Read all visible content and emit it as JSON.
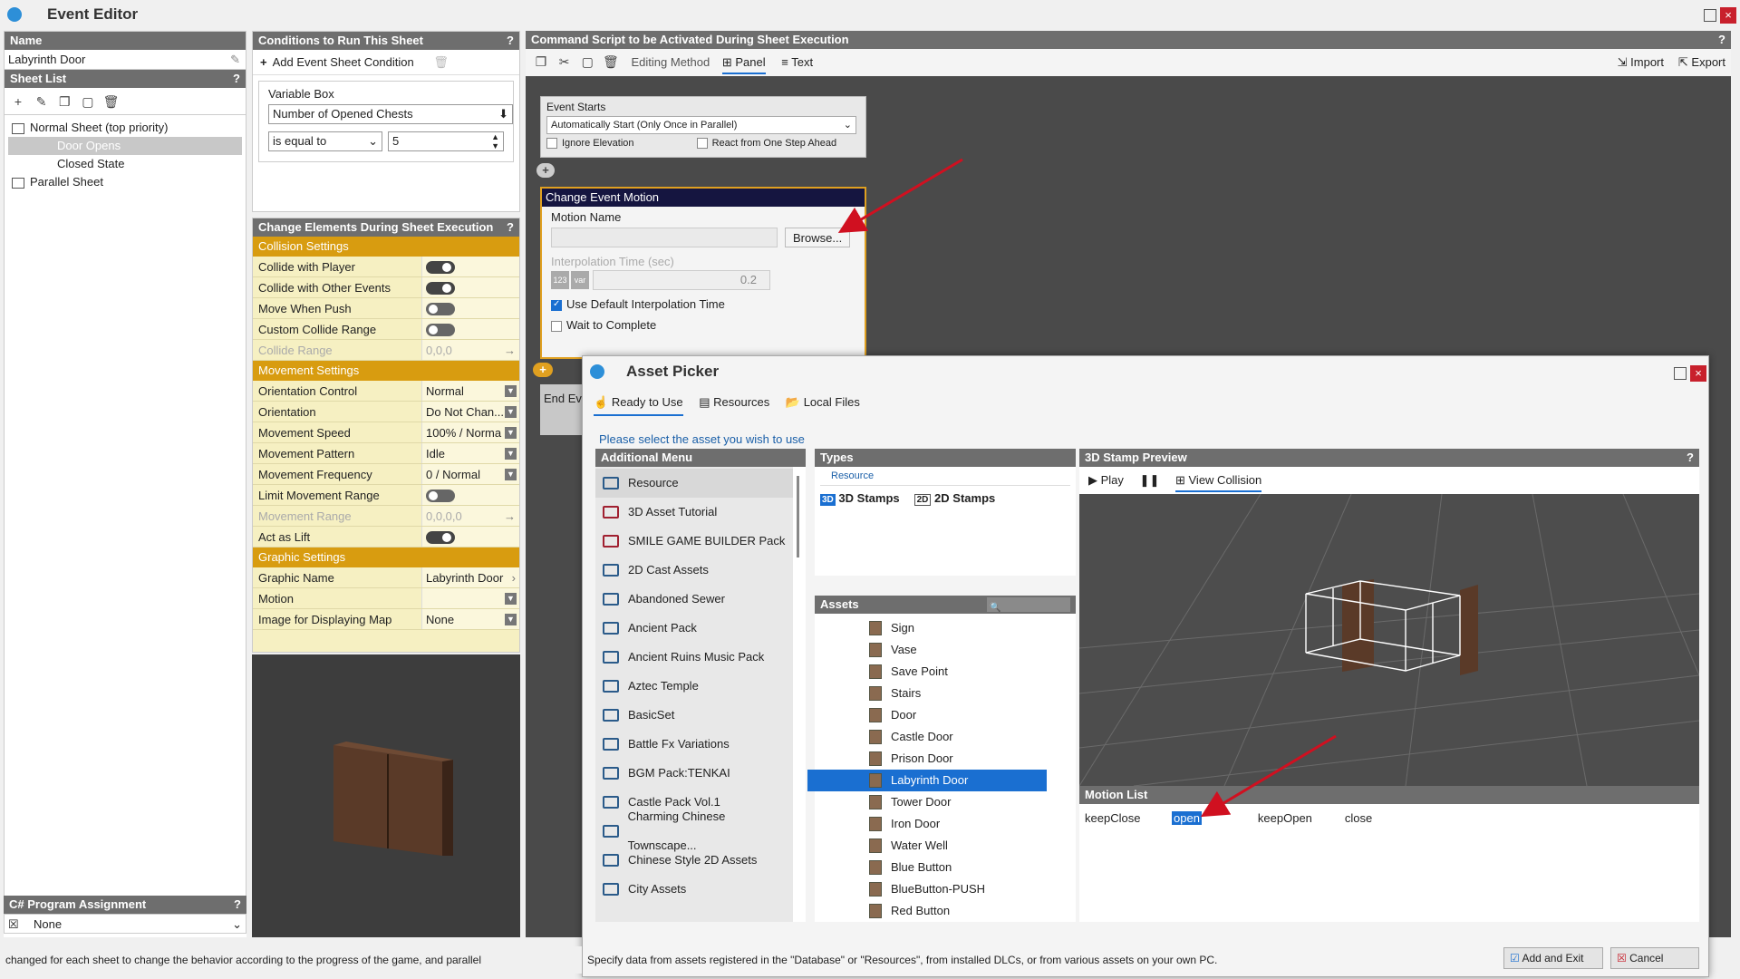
{
  "window": {
    "title": "Event Editor"
  },
  "left": {
    "name_header": "Name",
    "name_value": "Labyrinth Door",
    "sheet_list_header": "Sheet List",
    "sheets": [
      {
        "label": "Normal Sheet (top priority)"
      },
      {
        "label": "Door Opens"
      },
      {
        "label": "Closed State"
      },
      {
        "label": "Parallel Sheet"
      }
    ],
    "csharp_header": "C# Program Assignment",
    "csharp_value": "None"
  },
  "conditions": {
    "header": "Conditions to Run This Sheet",
    "add_label": "Add Event Sheet Condition",
    "variable_box_label": "Variable Box",
    "variable_value": "Number of Opened Chests",
    "operator": "is equal to",
    "operand": "5"
  },
  "elements": {
    "header": "Change Elements During Sheet Execution",
    "collision_header": "Collision Settings",
    "collision_rows": [
      {
        "label": "Collide with Player",
        "state": "on"
      },
      {
        "label": "Collide with Other Events",
        "state": "on"
      },
      {
        "label": "Move When Push",
        "state": "off"
      },
      {
        "label": "Custom Collide Range",
        "state": "off"
      }
    ],
    "collide_range": {
      "label": "Collide Range",
      "value": "0,0,0"
    },
    "movement_header": "Movement Settings",
    "movement_rows": [
      {
        "label": "Orientation Control",
        "value": "Normal"
      },
      {
        "label": "Orientation",
        "value": "Do Not Chan..."
      },
      {
        "label": "Movement Speed",
        "value": "100% / Norma"
      },
      {
        "label": "Movement Pattern",
        "value": "Idle"
      },
      {
        "label": "Movement Frequency",
        "value": "0 / Normal"
      }
    ],
    "limit_movement": {
      "label": "Limit Movement Range",
      "state": "off"
    },
    "movement_range": {
      "label": "Movement Range",
      "value": "0,0,0,0"
    },
    "act_as_lift": {
      "label": "Act as Lift",
      "state": "on"
    },
    "graphic_header": "Graphic Settings",
    "graphic_rows": [
      {
        "label": "Graphic Name",
        "value": "Labyrinth Door"
      },
      {
        "label": "Motion",
        "value": ""
      },
      {
        "label": "Image for Displaying Map",
        "value": "None"
      }
    ]
  },
  "script": {
    "header": "Command Script to be Activated During Sheet Execution",
    "editing_method": "Editing Method",
    "panel": "Panel",
    "text": "Text",
    "import": "Import",
    "export": "Export",
    "event_starts": "Event Starts",
    "start_mode": "Automatically Start (Only Once in Parallel)",
    "ignore_elevation": "Ignore Elevation",
    "react_one_step": "React from One Step Ahead",
    "motion_box_title": "Change Event Motion",
    "motion_name_label": "Motion Name",
    "browse": "Browse...",
    "interp_label": "Interpolation Time (sec)",
    "interp_value": "0.2",
    "use_default": "Use Default Interpolation Time",
    "wait_complete": "Wait to Complete",
    "end_event": "End Ev"
  },
  "picker": {
    "title": "Asset Picker",
    "tabs": [
      "Ready to Use",
      "Resources",
      "Local Files"
    ],
    "prompt": "Please select the asset you wish to use",
    "menu_header": "Additional Menu",
    "menu_items": [
      {
        "label": "Resource",
        "red": false
      },
      {
        "label": "3D Asset Tutorial",
        "red": true
      },
      {
        "label": "SMILE GAME BUILDER Pack",
        "red": true
      },
      {
        "label": "2D Cast Assets",
        "red": false
      },
      {
        "label": "Abandoned Sewer",
        "red": false
      },
      {
        "label": "Ancient Pack",
        "red": false
      },
      {
        "label": "Ancient Ruins Music Pack",
        "red": false
      },
      {
        "label": "Aztec Temple",
        "red": false
      },
      {
        "label": "BasicSet",
        "red": false
      },
      {
        "label": "Battle Fx Variations",
        "red": false
      },
      {
        "label": "BGM Pack:TENKAI",
        "red": false
      },
      {
        "label": "Castle Pack Vol.1",
        "red": false
      },
      {
        "label": "Charming Chinese Townscape...",
        "red": false
      },
      {
        "label": "Chinese Style 2D Assets",
        "red": false
      },
      {
        "label": "City Assets",
        "red": false
      }
    ],
    "types_header": "Types",
    "types_group": "Resource",
    "type_3d": "3D Stamps",
    "type_2d": "2D Stamps",
    "type_3d_icon": "3D",
    "type_2d_icon": "2D",
    "assets_header": "Assets",
    "assets": [
      {
        "label": "Sign"
      },
      {
        "label": "Vase"
      },
      {
        "label": "Save Point"
      },
      {
        "label": "Stairs"
      },
      {
        "label": "Door"
      },
      {
        "label": "Castle Door"
      },
      {
        "label": "Prison Door"
      },
      {
        "label": "Labyrinth Door"
      },
      {
        "label": "Tower Door"
      },
      {
        "label": "Iron Door"
      },
      {
        "label": "Water Well"
      },
      {
        "label": "Blue Button"
      },
      {
        "label": "BlueButton-PUSH"
      },
      {
        "label": "Red Button"
      }
    ],
    "selected_asset": "Labyrinth Door",
    "preview_header": "3D Stamp Preview",
    "play": "Play",
    "view_collision": "View Collision",
    "motion_list_header": "Motion List",
    "motions": [
      "keepClose",
      "open",
      "keepOpen",
      "close"
    ],
    "selected_motion": "open",
    "add_exit": "Add and Exit",
    "cancel": "Cancel"
  },
  "status": {
    "left_text": "changed for each sheet to change the behavior according to the progress of the game, and parallel",
    "right_text": "Specify data from assets registered in the \"Database\" or \"Resources\", from installed DLCs, or from various assets on your own PC."
  },
  "colors": {
    "accent": "#d89c10",
    "selection": "#1a6fd1",
    "header": "#6e6e6e",
    "arrow": "#d01020"
  }
}
